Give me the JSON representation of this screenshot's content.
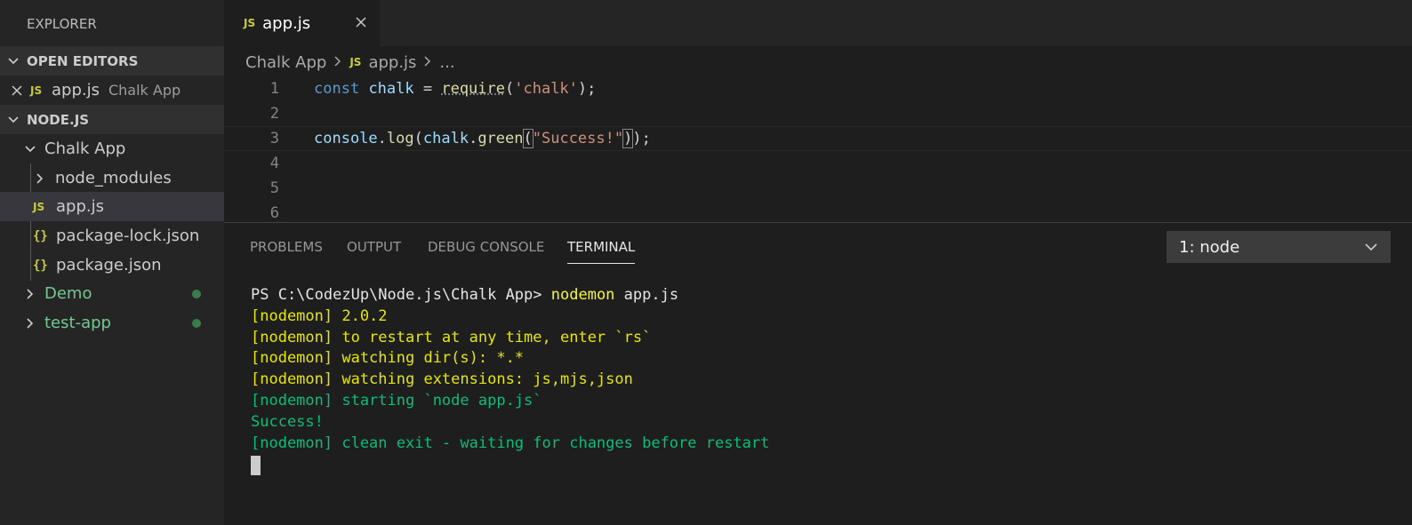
{
  "sidebar": {
    "title": "EXPLORER",
    "open_editors": {
      "header": "OPEN EDITORS",
      "item": {
        "badge": "JS",
        "name": "app.js",
        "folder": "Chalk App"
      }
    },
    "workspace": {
      "header": "NODE.JS",
      "folder": "Chalk App",
      "items": [
        {
          "name": "node_modules"
        },
        {
          "badge": "JS",
          "name": "app.js"
        },
        {
          "badge": "{}",
          "name": "package-lock.json"
        },
        {
          "badge": "{}",
          "name": "package.json"
        }
      ],
      "others": [
        {
          "name": "Demo"
        },
        {
          "name": "test-app"
        }
      ]
    }
  },
  "tabs": [
    {
      "badge": "JS",
      "label": "app.js"
    }
  ],
  "breadcrumb": {
    "folder": "Chalk App",
    "badge": "JS",
    "file": "app.js",
    "more": "..."
  },
  "editor": {
    "line_numbers": [
      "1",
      "2",
      "3",
      "4",
      "5",
      "6"
    ],
    "line1": {
      "kw": "const",
      "var": "chalk",
      "op": " = ",
      "fn": "require",
      "open": "(",
      "str": "'chalk'",
      "close": ");"
    },
    "line3": {
      "obj": "console",
      "dot1": ".",
      "fn1": "log",
      "open1": "(",
      "obj2": "chalk",
      "dot2": ".",
      "fn2": "green",
      "open2": "(",
      "str": "\"Success!\"",
      "close2": ")",
      "close1": ");"
    }
  },
  "panel": {
    "tabs": [
      "PROBLEMS",
      "OUTPUT",
      "DEBUG CONSOLE",
      "TERMINAL"
    ],
    "active_tab": "TERMINAL",
    "terminal_select": "1: node",
    "terminal": {
      "prompt": "PS C:\\CodezUp\\Node.js\\Chalk App> ",
      "command": "nodemon",
      "arg": " app.js",
      "lines_yellow": [
        "[nodemon] 2.0.2",
        "[nodemon] to restart at any time, enter `rs`",
        "[nodemon] watching dir(s): *.*",
        "[nodemon] watching extensions: js,mjs,json"
      ],
      "lines_green": [
        "[nodemon] starting `node app.js`",
        "Success!",
        "[nodemon] clean exit - waiting for changes before restart"
      ]
    }
  },
  "colors": {
    "editor_bg": "#1e1e1e",
    "sidebar_bg": "#252526",
    "js_badge": "#cbcb41",
    "git_green": "#73c991",
    "terminal_yellow": "#e5e510",
    "terminal_green": "#0dbc79"
  }
}
